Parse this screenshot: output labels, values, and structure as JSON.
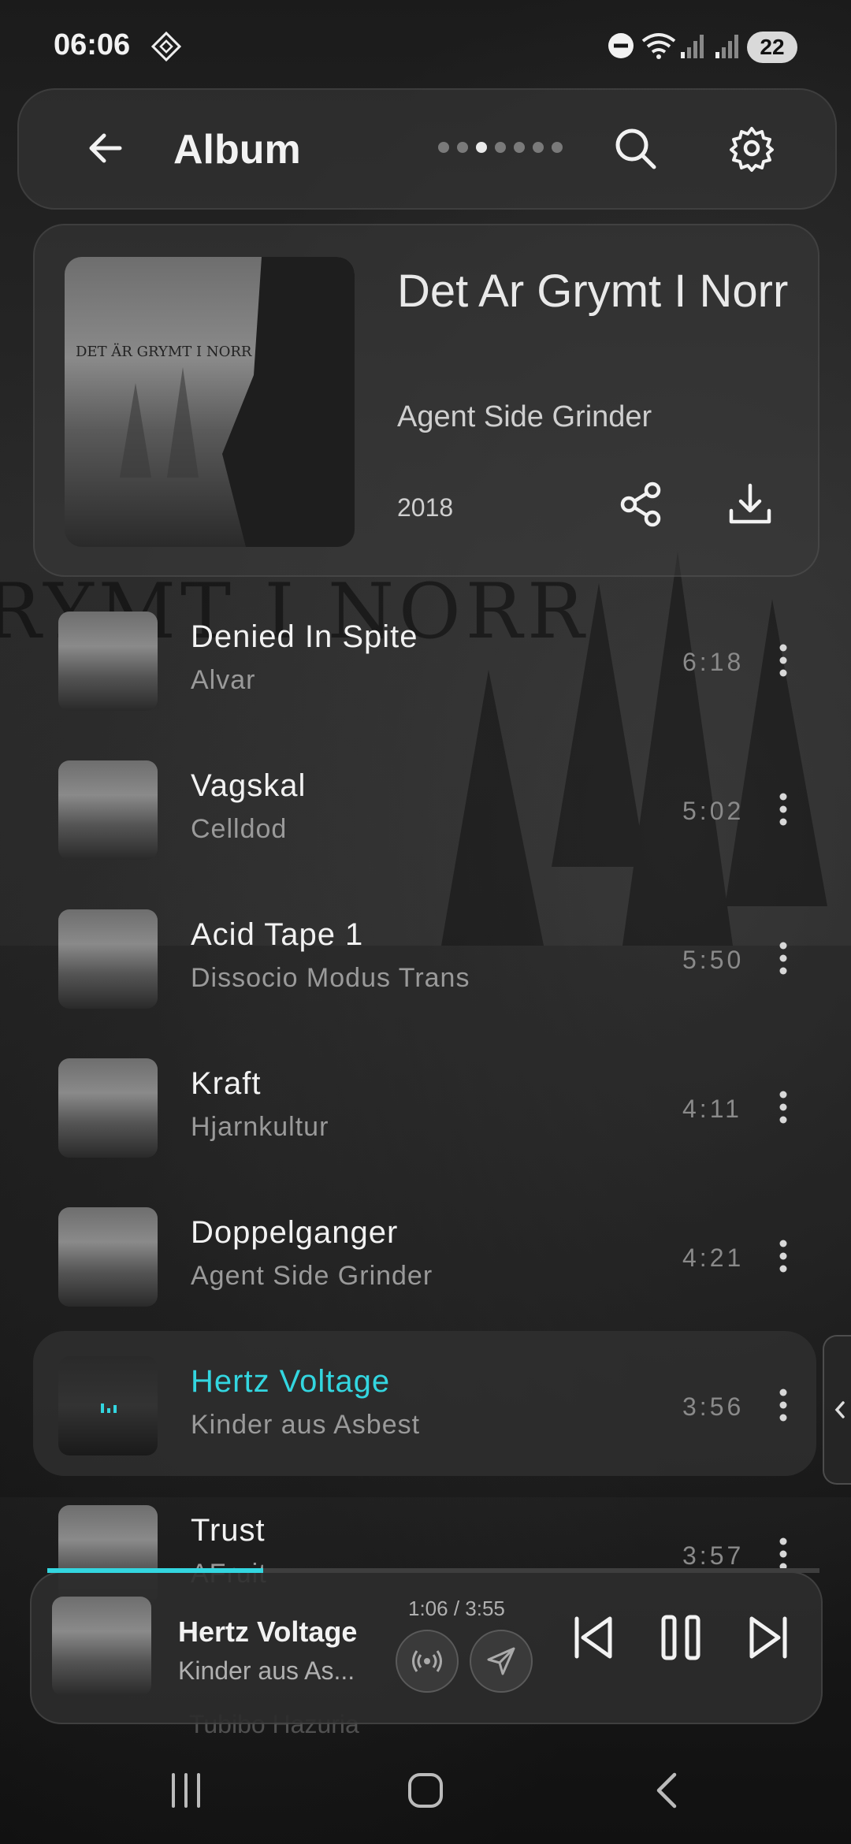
{
  "status_bar": {
    "time": "06:06",
    "battery": "22"
  },
  "header": {
    "title": "Album",
    "page_dots": 7,
    "active_dot": 2,
    "icons": [
      "back-arrow-icon",
      "search-icon",
      "gear-icon"
    ]
  },
  "album": {
    "title": "Det Ar Grymt I Norr",
    "artist": "Agent Side Grinder",
    "year": "2018",
    "cover_text": "DET ÄR GRYMT I NORR",
    "background_text": "RYMT I NORR"
  },
  "tracks": [
    {
      "name": "Denied In Spite",
      "artist": "Alvar",
      "duration": "6:18"
    },
    {
      "name": "Vagskal",
      "artist": "Celldod",
      "duration": "5:02"
    },
    {
      "name": "Acid Tape 1",
      "artist": "Dissocio Modus Trans",
      "duration": "5:50"
    },
    {
      "name": "Kraft",
      "artist": "Hjarnkultur",
      "duration": "4:11"
    },
    {
      "name": "Doppelganger",
      "artist": "Agent Side Grinder",
      "duration": "4:21"
    },
    {
      "name": "Hertz Voltage",
      "artist": "Kinder aus Asbest",
      "duration": "3:56",
      "playing": true
    },
    {
      "name": "Trust",
      "artist": "AFruit",
      "duration": "3:57"
    }
  ],
  "player": {
    "title": "Hertz Voltage",
    "artist": "Kinder aus As...",
    "time": "1:06 / 3:55",
    "progress": 0.28
  },
  "peek_text": "Tubibo Hazuria",
  "colors": {
    "accent": "#33d6e0",
    "background": "#141414"
  }
}
